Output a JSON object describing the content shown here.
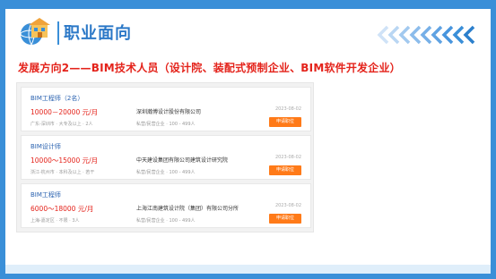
{
  "header": {
    "title": "职业面向"
  },
  "section": {
    "heading": "发展方向2——BIM技术人员（设计院、装配式预制企业、BIM软件开发企业）"
  },
  "jobs": [
    {
      "title": "BIM工程师（2名）",
      "salary": "10000－20000 元/月",
      "meta": "广东-深圳市 · 大专及以上 · 2人",
      "company": "深圳瀚博设计股份有限公司",
      "info": "私营/民营企业 · 100 - 499人",
      "date": "2023-08-02",
      "apply_label": "申请职位"
    },
    {
      "title": "BIM设计师",
      "salary": "10000～15000 元/月",
      "meta": "浙江-杭州市 · 本科及以上 · 若干",
      "company": "中天建设集团有限公司建筑设计研究院",
      "info": "私营/民营企业 · 100 - 499人",
      "date": "2023-08-02",
      "apply_label": "申请职位"
    },
    {
      "title": "BIM工程师",
      "salary": "6000～18000 元/月",
      "meta": "上海-嘉定区 · 不限 · 3人",
      "company": "上海江南建筑设计院（集团）有限公司分所",
      "info": "私营/民营企业 · 100 - 499人",
      "date": "2023-08-02",
      "apply_label": "申请职位"
    }
  ],
  "colors": {
    "frame": "#3a8fd8",
    "heading": "#e4231b",
    "button": "#ff7a18"
  },
  "icons": {
    "logo": "house-on-globe-logo",
    "decoration": "chevron-left-arrows"
  }
}
